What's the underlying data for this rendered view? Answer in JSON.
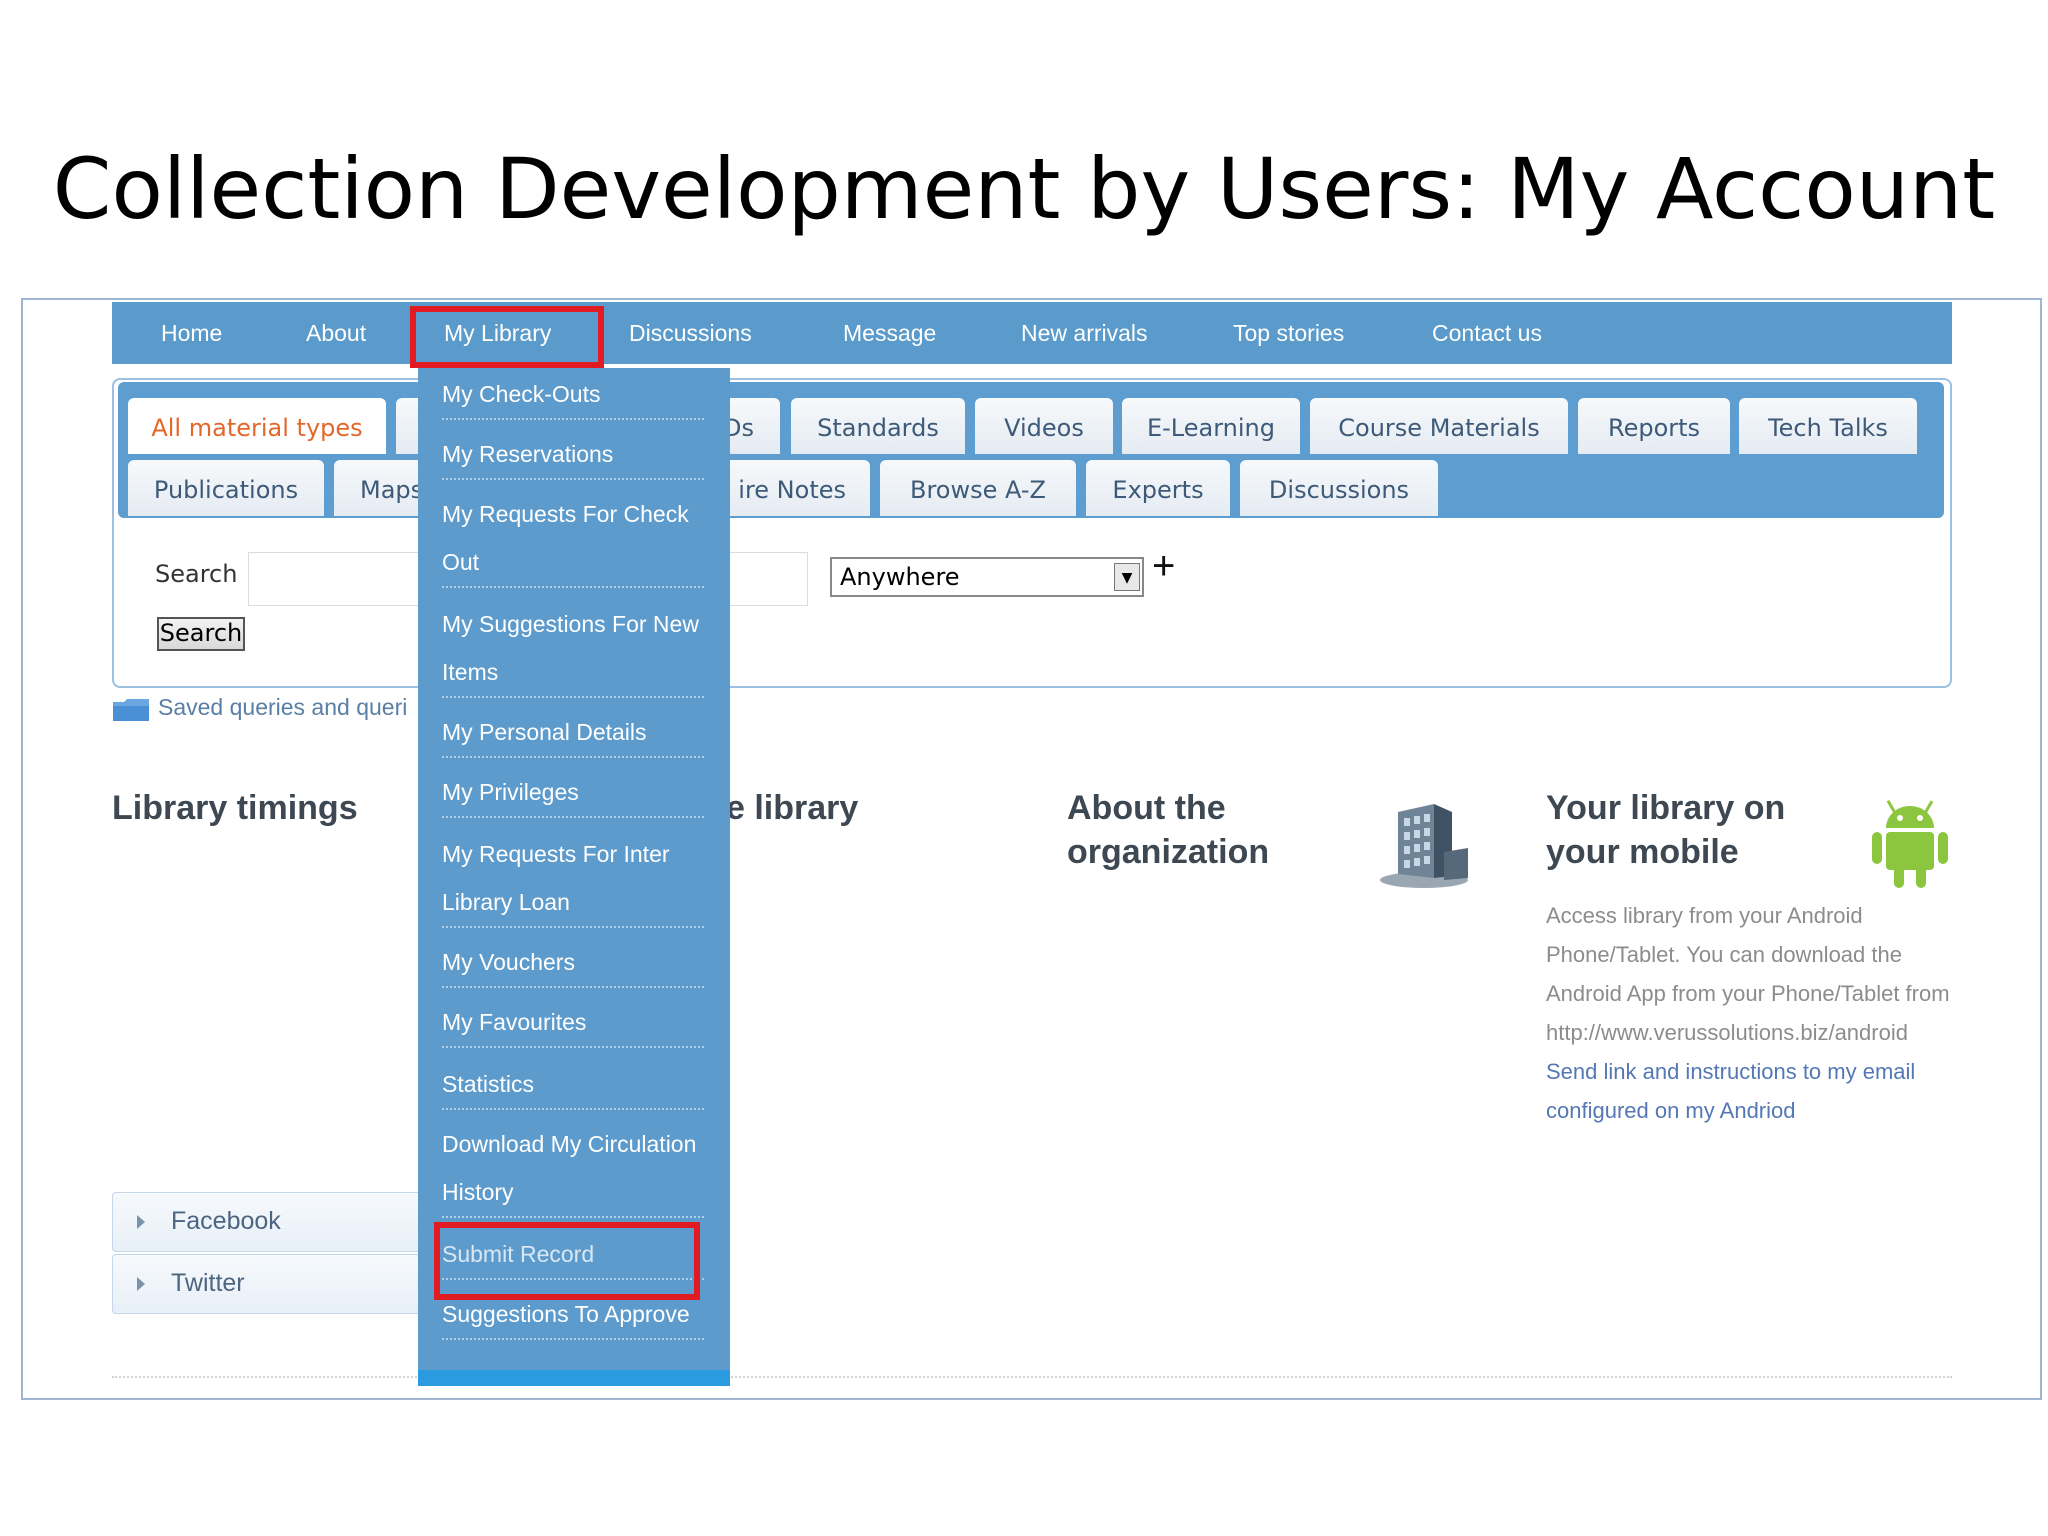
{
  "slide": {
    "title": "Collection Development by Users: My Account"
  },
  "topnav": {
    "items": [
      "Home",
      "About",
      "My Library",
      "Discussions",
      "Message",
      "New arrivals",
      "Top stories",
      "Contact us"
    ]
  },
  "tabs": {
    "row1": [
      "All material types",
      "",
      "Ds",
      "Standards",
      "Videos",
      "E-Learning",
      "Course Materials",
      "Reports",
      "Tech Talks"
    ],
    "row2": [
      "Publications",
      "Maps",
      "ire Notes",
      "Browse A-Z",
      "Experts",
      "Discussions"
    ]
  },
  "search": {
    "label": "Search",
    "button_label": "Search",
    "input_value": "",
    "scope_selected": "Anywhere",
    "add_symbol": "+"
  },
  "saved_queries": {
    "label": "Saved queries and queri"
  },
  "sections": {
    "library_timings": "Library timings",
    "the_library": "e library",
    "about_org": "About the organization",
    "mobile_title": "Your library on your mobile",
    "mobile_text": "Access library from your Android Phone/Tablet. You can download the Android App from your Phone/Tablet from http://www.verussolutions.biz/android",
    "mobile_link": "Send link and instructions to my email configured on my Andriod"
  },
  "social": {
    "facebook": "Facebook",
    "twitter": "Twitter"
  },
  "dropdown": {
    "items": [
      "My Check-Outs",
      "My Reservations",
      "My Requests For Check Out",
      "My Suggestions For New Items",
      "My Personal Details",
      "My Privileges",
      "My Requests For Inter Library Loan",
      "My Vouchers",
      "My Favourites",
      "Statistics",
      "Download My Circulation History",
      "Submit Record",
      "Suggestions To Approve"
    ]
  },
  "colors": {
    "nav_blue": "#5b9bcb",
    "highlight_red": "#e01b22",
    "active_tab_orange": "#e4672a"
  },
  "icons": {
    "folder": "folder-icon",
    "building": "building-icon",
    "android": "android-icon",
    "plus": "plus-icon"
  }
}
